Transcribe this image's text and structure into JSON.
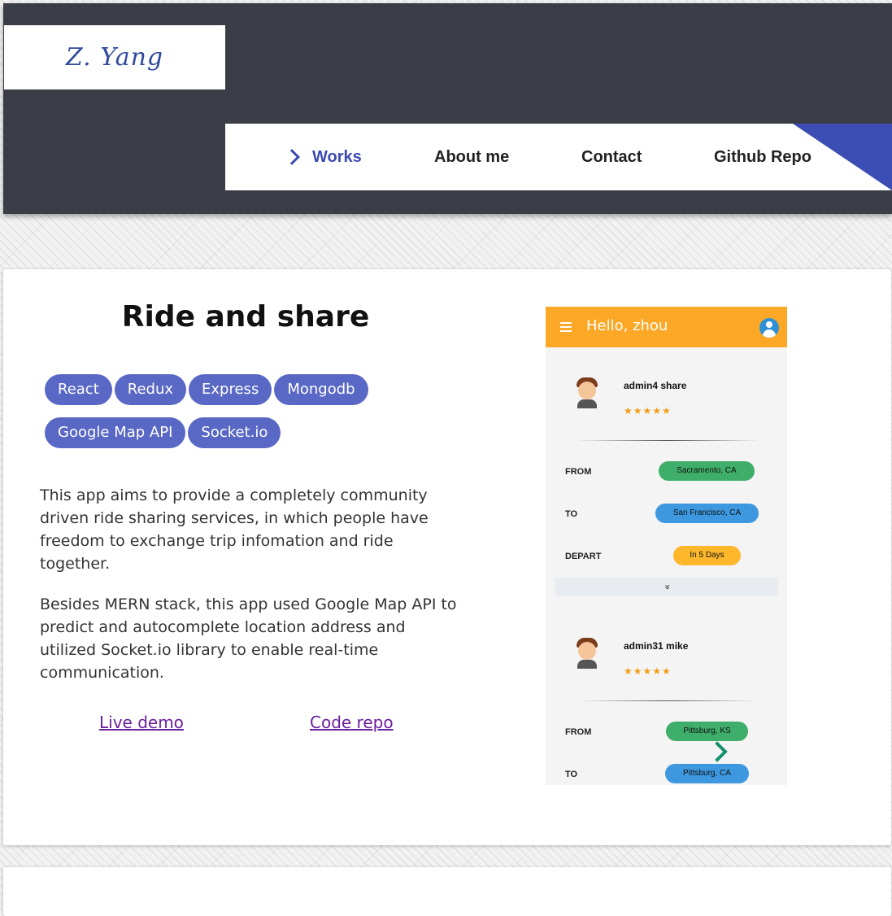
{
  "logo": {
    "text": "Z. Yang"
  },
  "nav": {
    "items": [
      {
        "label": "Works",
        "active": true
      },
      {
        "label": "About me"
      },
      {
        "label": "Contact"
      },
      {
        "label": "Github Repo"
      }
    ]
  },
  "project": {
    "title": "Ride and share",
    "tags": [
      "React",
      "Redux",
      "Express",
      "Mongodb",
      "Google Map API",
      "Socket.io"
    ],
    "description": [
      "This app aims to provide a completely community driven ride sharing services, in which people have freedom to exchange trip infomation and ride together.",
      "Besides MERN stack, this app used Google Map API to predict and autocomplete location address and utilized Socket.io library to enable real-time communication."
    ],
    "links": {
      "live_demo": "Live demo",
      "code_repo": "Code repo"
    }
  },
  "screenshot": {
    "app_title": "Hello, zhou",
    "rides": [
      {
        "user": "admin4 share",
        "rating": "★★★★★",
        "from_label": "FROM",
        "from": "Sacramento, CA",
        "to_label": "TO",
        "to": "San Francisco, CA",
        "depart_label": "DEPART",
        "depart": "In 5 Days"
      },
      {
        "user": "admin31 mike",
        "rating": "★★★★★",
        "from_label": "FROM",
        "from": "Pittsburg, KS",
        "to_label": "TO",
        "to": "Pittsburg, CA"
      }
    ],
    "expand_glyph": "»"
  },
  "colors": {
    "header_bg": "#3a3d46",
    "accent": "#3b4bb0",
    "tag_bg": "#5a68c5",
    "app_bar": "#fba827"
  }
}
